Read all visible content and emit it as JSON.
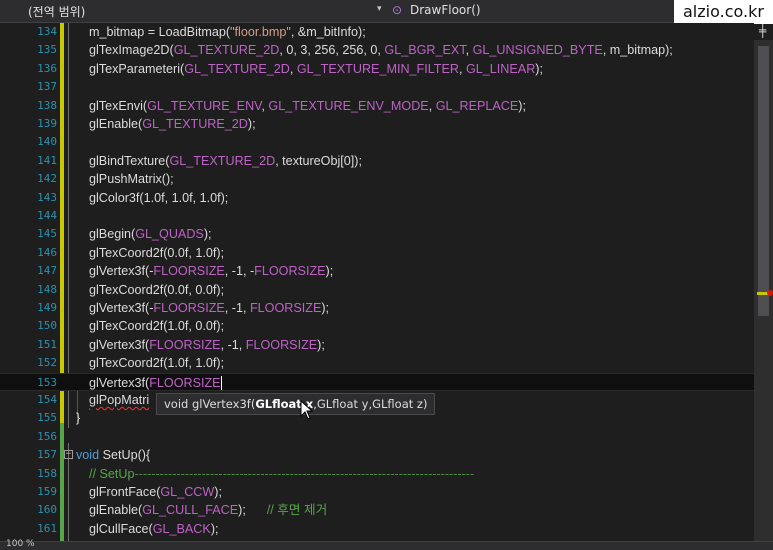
{
  "header": {
    "scope_label": "(전역 범위)",
    "dropdown_arrow": "▾",
    "function_icon": "⊙",
    "function_name": "DrawFloor()",
    "split_icon": "╪"
  },
  "watermark": "alzio.co.kr",
  "tooltip": {
    "prefix": "void glVertex3f(",
    "bold_param": "GLfloat x",
    "rest": ",GLfloat y,GLfloat z)"
  },
  "statusbar": {
    "zoom": "100 %"
  },
  "editor": {
    "lines": [
      {
        "n": "134",
        "code": "m_bitmap = LoadBitmap(\"floor.bmp\", &m_bitInfo);"
      },
      {
        "n": "135",
        "code": "glTexImage2D(GL_TEXTURE_2D, 0, 3, 256, 256, 0, GL_BGR_EXT, GL_UNSIGNED_BYTE, m_bitmap);"
      },
      {
        "n": "136",
        "code": "glTexParameteri(GL_TEXTURE_2D, GL_TEXTURE_MIN_FILTER, GL_LINEAR);"
      },
      {
        "n": "137",
        "code": ""
      },
      {
        "n": "138",
        "code": "glTexEnvi(GL_TEXTURE_ENV, GL_TEXTURE_ENV_MODE, GL_REPLACE);"
      },
      {
        "n": "139",
        "code": "glEnable(GL_TEXTURE_2D);"
      },
      {
        "n": "140",
        "code": ""
      },
      {
        "n": "141",
        "code": "glBindTexture(GL_TEXTURE_2D, textureObj[0]);"
      },
      {
        "n": "142",
        "code": "glPushMatrix();"
      },
      {
        "n": "143",
        "code": "glColor3f(1.0f, 1.0f, 1.0f);"
      },
      {
        "n": "144",
        "code": ""
      },
      {
        "n": "145",
        "code": "glBegin(GL_QUADS);"
      },
      {
        "n": "146",
        "code": "glTexCoord2f(0.0f, 1.0f);"
      },
      {
        "n": "147",
        "code": "glVertex3f(-FLOORSIZE, -1, -FLOORSIZE);"
      },
      {
        "n": "148",
        "code": "glTexCoord2f(0.0f, 0.0f);"
      },
      {
        "n": "149",
        "code": "glVertex3f(-FLOORSIZE, -1, FLOORSIZE);"
      },
      {
        "n": "150",
        "code": "glTexCoord2f(1.0f, 0.0f);"
      },
      {
        "n": "151",
        "code": "glVertex3f(FLOORSIZE, -1, FLOORSIZE);"
      },
      {
        "n": "152",
        "code": "glTexCoord2f(1.0f, 1.0f);"
      },
      {
        "n": "153",
        "code": "glVertex3f(FLOORSIZE)"
      },
      {
        "n": "154",
        "code": "glPopMatri"
      },
      {
        "n": "155",
        "code": "}"
      },
      {
        "n": "156",
        "code": ""
      },
      {
        "n": "157",
        "code": "void SetUp(){"
      },
      {
        "n": "158",
        "code": "// SetUp---------------------------------------------------------------------------------"
      },
      {
        "n": "159",
        "code": "glFrontFace(GL_CCW);"
      },
      {
        "n": "160",
        "code": "glEnable(GL_CULL_FACE);      // 후면 제거"
      },
      {
        "n": "161",
        "code": "glCullFace(GL_BACK);"
      }
    ]
  },
  "colors": {
    "background": "#1e1e1e",
    "line_number": "#2b91af",
    "macro": "#bd63c5",
    "string": "#d69d85",
    "comment": "#57a64a",
    "keyword": "#569cd6",
    "change_bar_yellow": "#c8c800",
    "change_bar_green": "#57a64a"
  }
}
